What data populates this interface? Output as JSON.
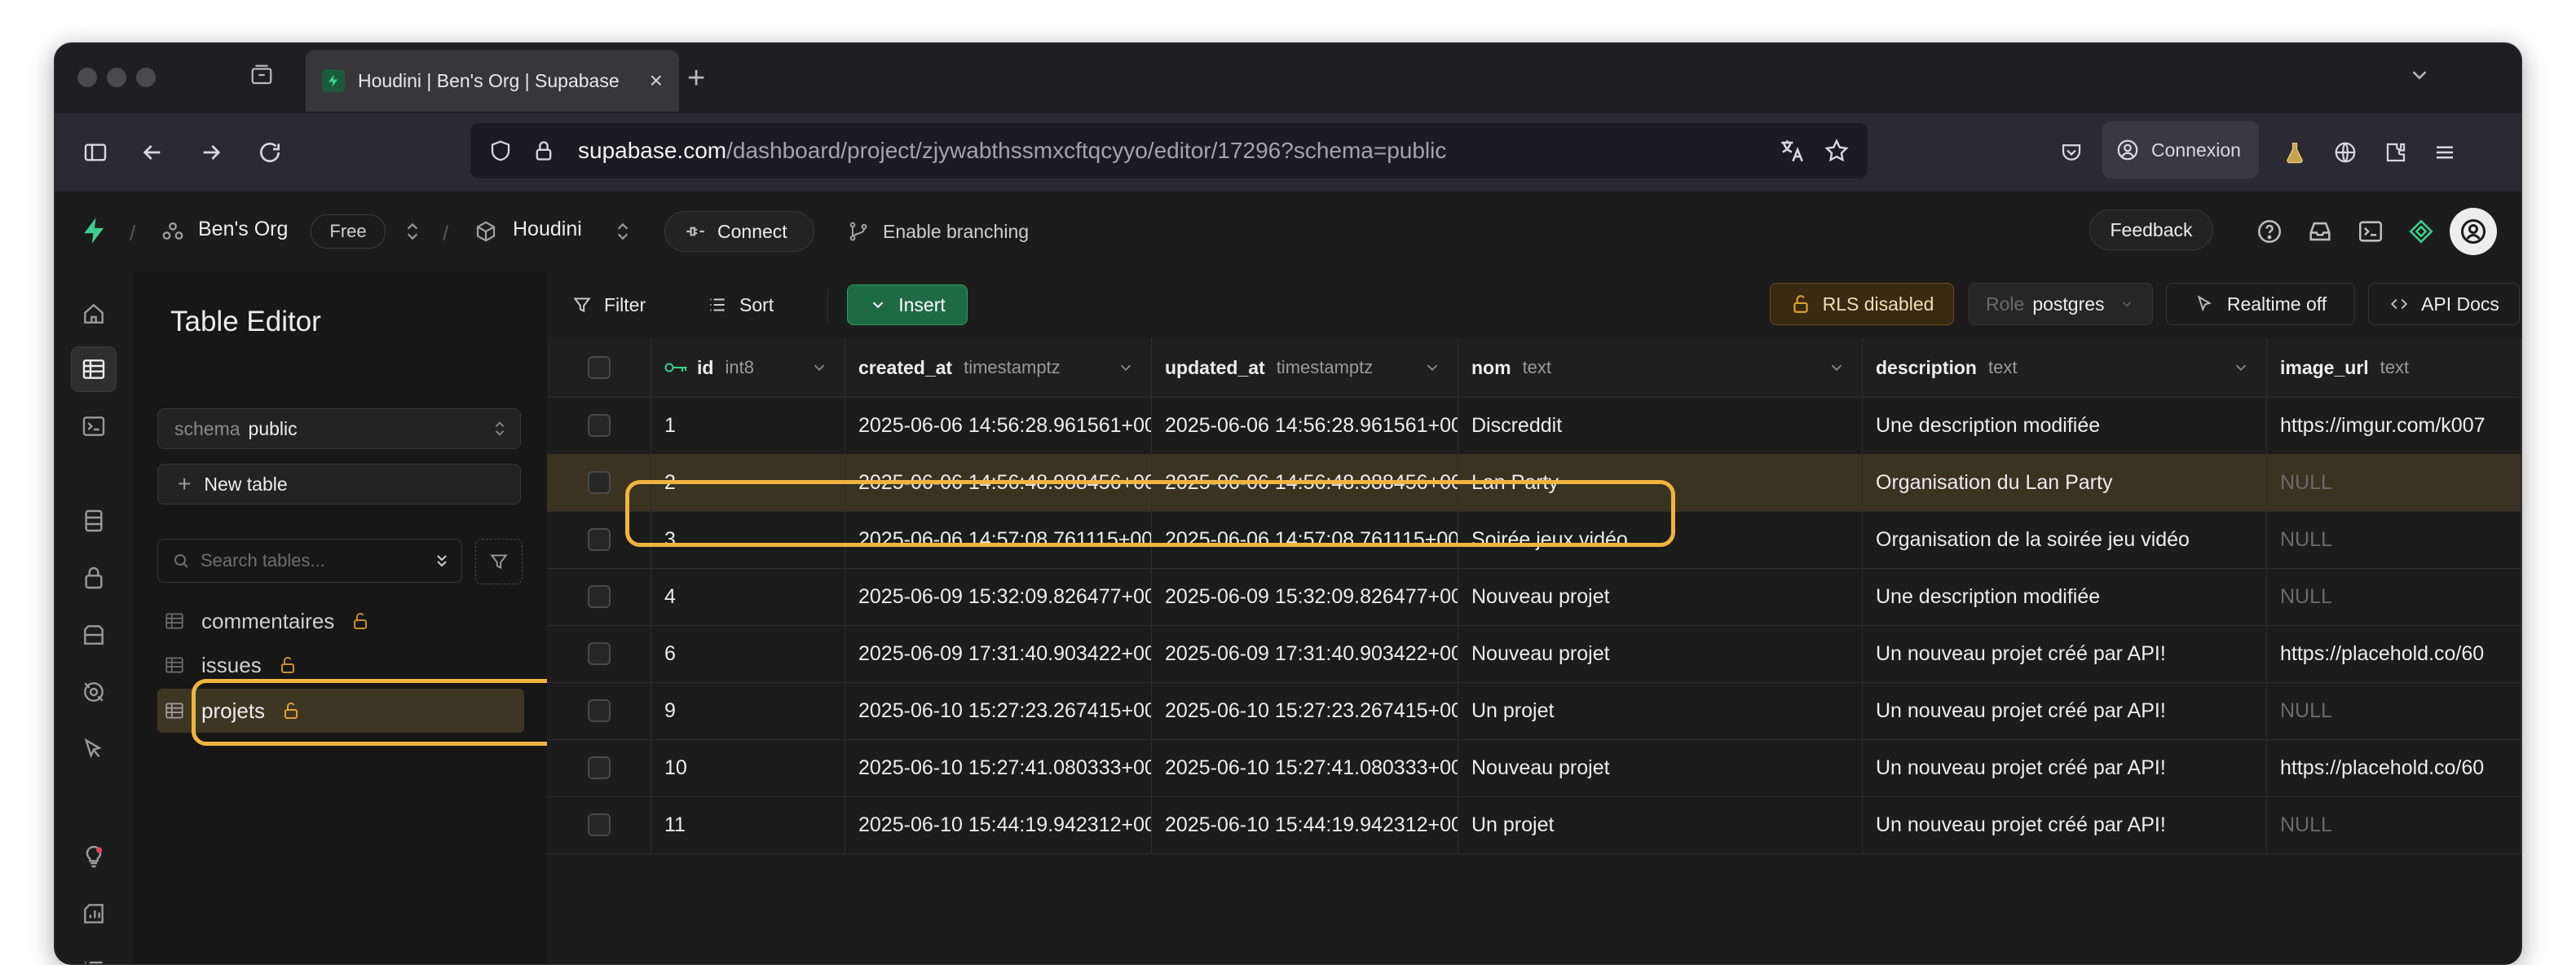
{
  "browser": {
    "tab_title": "Houdini | Ben's Org | Supabase",
    "tab_close": "×",
    "new_tab": "+",
    "url_host": "supabase.com",
    "url_path": "/dashboard/project/zjywabthssmxcftqcyyo/editor/17296?schema=public",
    "account_label": "Connexion"
  },
  "header": {
    "org_name": "Ben's Org",
    "plan_badge": "Free",
    "project_name": "Houdini",
    "connect_label": "Connect",
    "branching_label": "Enable branching",
    "feedback_label": "Feedback"
  },
  "sidebar": {
    "title": "Table Editor",
    "schema_prefix": "schema",
    "schema_value": "public",
    "new_table_label": "New table",
    "search_placeholder": "Search tables...",
    "tables": [
      {
        "name": "commentaires"
      },
      {
        "name": "issues"
      },
      {
        "name": "projets",
        "active": true
      }
    ]
  },
  "grid_toolbar": {
    "filter_label": "Filter",
    "sort_label": "Sort",
    "insert_label": "Insert",
    "rls_label": "RLS disabled",
    "role_prefix": "Role",
    "role_value": "postgres",
    "realtime_label": "Realtime off",
    "api_docs_label": "API Docs"
  },
  "columns": [
    {
      "name": "id",
      "type": "int8",
      "primary_key": true
    },
    {
      "name": "created_at",
      "type": "timestamptz"
    },
    {
      "name": "updated_at",
      "type": "timestamptz"
    },
    {
      "name": "nom",
      "type": "text"
    },
    {
      "name": "description",
      "type": "text"
    },
    {
      "name": "image_url",
      "type": "text"
    }
  ],
  "rows": [
    {
      "id": "1",
      "created_at": "2025-06-06 14:56:28.961561+00",
      "updated_at": "2025-06-06 14:56:28.961561+00",
      "nom": "Discreddit",
      "description": "Une description modifiée",
      "image_url": "https://imgur.com/k007"
    },
    {
      "id": "2",
      "created_at": "2025-06-06 14:56:48.988456+00",
      "updated_at": "2025-06-06 14:56:48.988456+00",
      "nom": "Lan Party",
      "description": "Organisation du Lan Party",
      "image_url": "NULL",
      "selected": true
    },
    {
      "id": "3",
      "created_at": "2025-06-06 14:57:08.761115+00",
      "updated_at": "2025-06-06 14:57:08.761115+00",
      "nom": "Soirée jeux vidéo",
      "description": "Organisation de la soirée jeu vidéo",
      "image_url": "NULL"
    },
    {
      "id": "4",
      "created_at": "2025-06-09 15:32:09.826477+00",
      "updated_at": "2025-06-09 15:32:09.826477+00",
      "nom": "Nouveau projet",
      "description": "Une description modifiée",
      "image_url": "NULL"
    },
    {
      "id": "6",
      "created_at": "2025-06-09 17:31:40.903422+00",
      "updated_at": "2025-06-09 17:31:40.903422+00",
      "nom": "Nouveau projet",
      "description": "Un nouveau projet créé par API!",
      "image_url": "https://placehold.co/60"
    },
    {
      "id": "9",
      "created_at": "2025-06-10 15:27:23.267415+00",
      "updated_at": "2025-06-10 15:27:23.267415+00",
      "nom": "Un projet",
      "description": "Un nouveau projet créé par API!",
      "image_url": "NULL"
    },
    {
      "id": "10",
      "created_at": "2025-06-10 15:27:41.080333+00",
      "updated_at": "2025-06-10 15:27:41.080333+00",
      "nom": "Nouveau projet",
      "description": "Un nouveau projet créé par API!",
      "image_url": "https://placehold.co/60"
    },
    {
      "id": "11",
      "created_at": "2025-06-10 15:44:19.942312+00",
      "updated_at": "2025-06-10 15:44:19.942312+00",
      "nom": "Un projet",
      "description": "Un nouveau projet créé par API!",
      "image_url": "NULL"
    }
  ],
  "colors": {
    "brand_green": "#3ecf8e",
    "insert_green": "#1e6b43",
    "highlight_orange": "#f0b440",
    "rls_warning": "#6e4a16"
  }
}
